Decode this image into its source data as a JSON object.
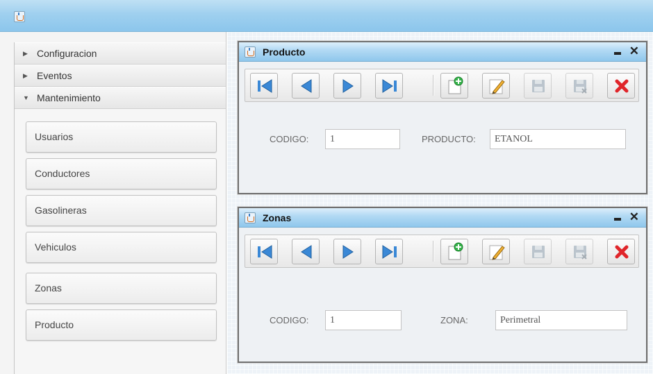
{
  "sidebar": {
    "sections": [
      {
        "label": "Configuracion",
        "expanded": false
      },
      {
        "label": "Eventos",
        "expanded": false
      },
      {
        "label": "Mantenimiento",
        "expanded": true
      }
    ],
    "items": [
      "Usuarios",
      "Conductores",
      "Gasolineras",
      "Vehiculos",
      "Zonas",
      "Producto"
    ]
  },
  "frames": {
    "producto": {
      "title": "Producto",
      "fields": [
        {
          "label": "CODIGO:",
          "value": "1"
        },
        {
          "label": "PRODUCTO:",
          "value": "ETANOL"
        }
      ]
    },
    "zonas": {
      "title": "Zonas",
      "fields": [
        {
          "label": "CODIGO:",
          "value": "1"
        },
        {
          "label": "ZONA:",
          "value": "Perimetral"
        }
      ]
    }
  },
  "toolbar_icons": [
    "first-record-icon",
    "previous-record-icon",
    "next-record-icon",
    "last-record-icon",
    "new-record-icon",
    "edit-icon",
    "save-icon",
    "save-close-icon",
    "delete-icon"
  ],
  "colors": {
    "titlebar": "#9fd0ef",
    "nav_blue": "#3a88d6",
    "delete_red": "#e0252a"
  }
}
